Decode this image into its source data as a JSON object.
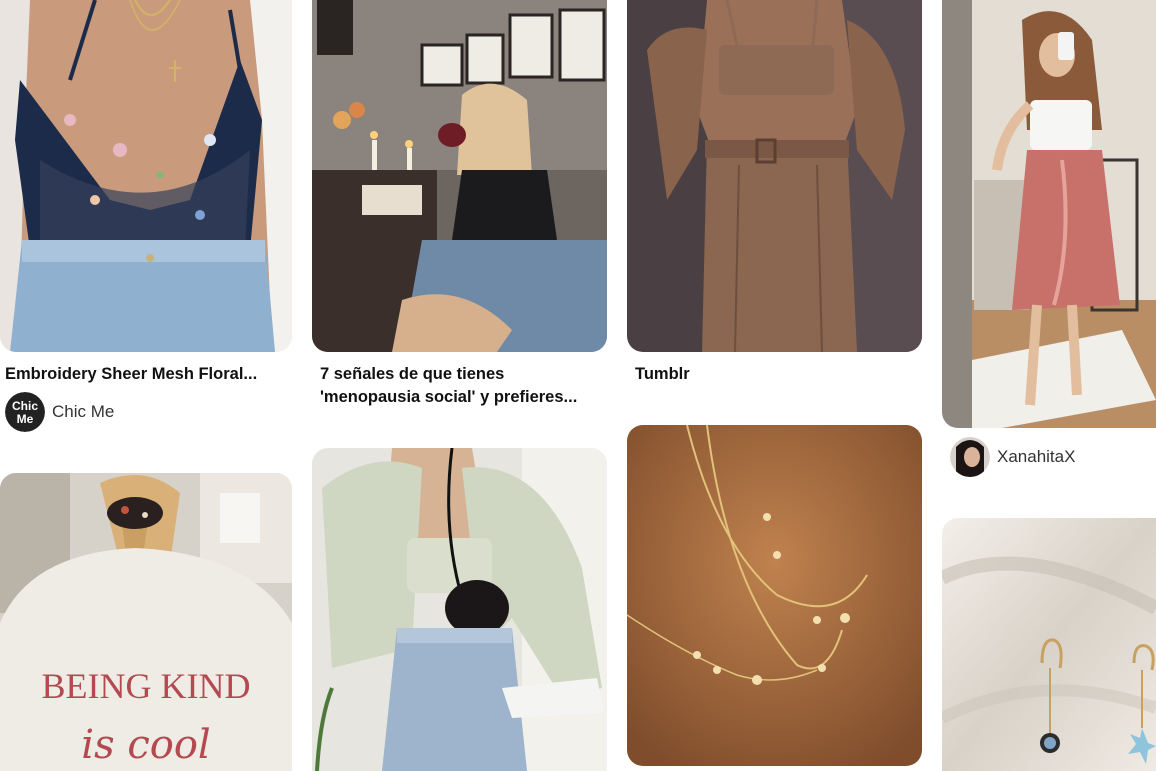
{
  "pins": {
    "embroidery": {
      "title": "Embroidery Sheer Mesh Floral...",
      "pinner": "Chic Me",
      "avatar_text_top": "Chic",
      "avatar_text_bottom": "Me"
    },
    "menopausia": {
      "title_line1": "7 señales de que tienes",
      "title_line2": "'menopausia social' y prefieres..."
    },
    "tumblr": {
      "title": "Tumblr"
    },
    "satin_skirt": {
      "pinner": "XanahitaX"
    },
    "sweatshirt": {
      "print_text_1": "BEING KIND",
      "print_text_2": "is cool"
    }
  },
  "colors": {
    "text_primary": "#111111",
    "text_secondary": "#333333",
    "background": "#ffffff"
  }
}
